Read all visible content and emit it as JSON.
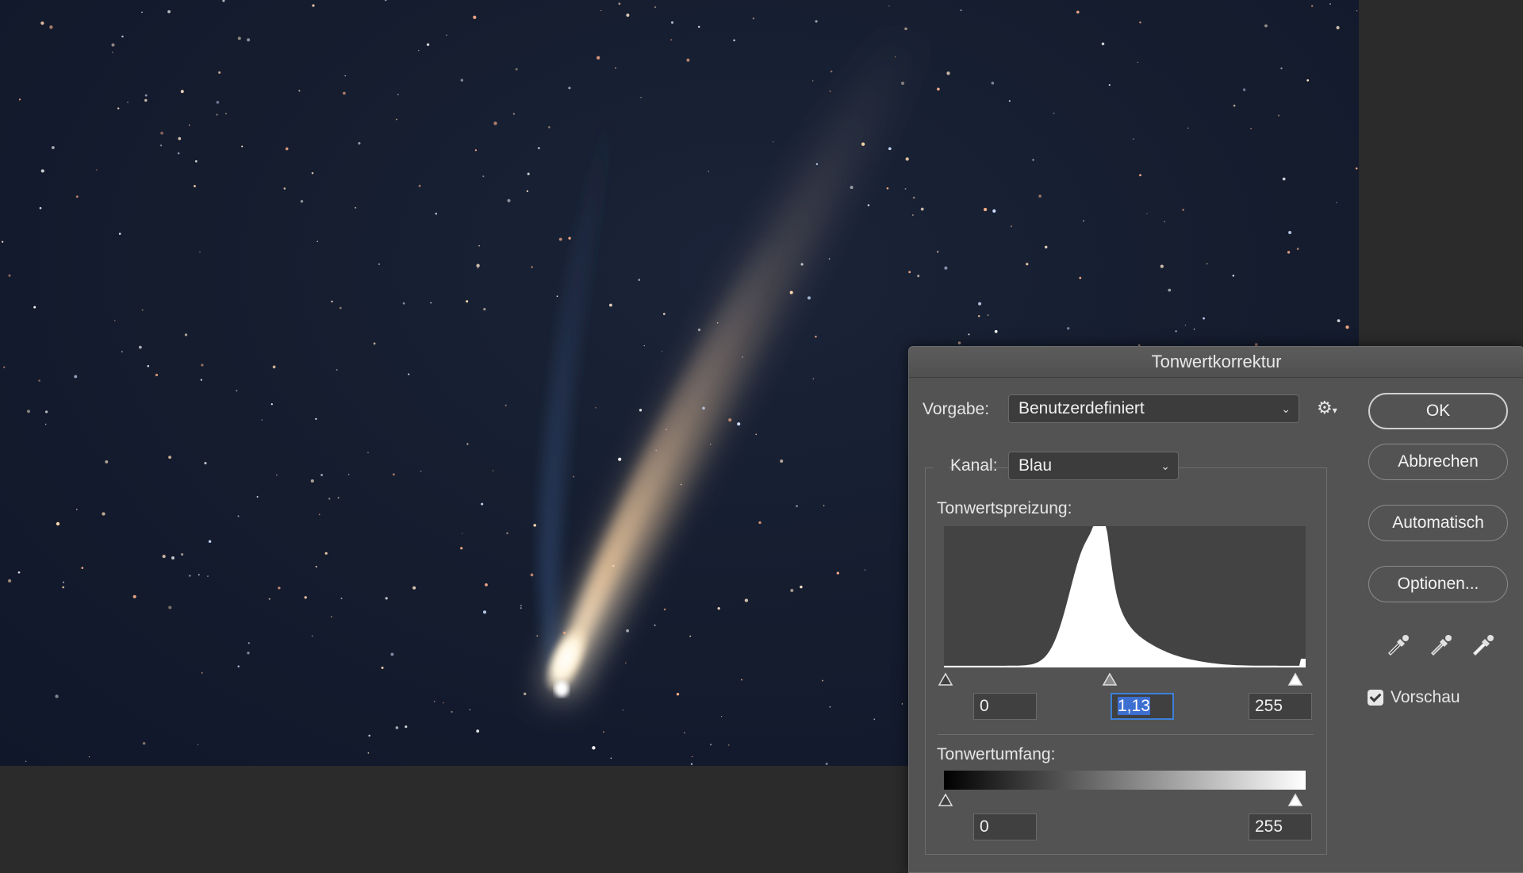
{
  "dialog": {
    "title": "Tonwertkorrektur",
    "preset_label": "Vorgabe:",
    "preset_value": "Benutzerdefiniert",
    "channel_label": "Kanal:",
    "channel_value": "Blau",
    "input_levels_label": "Tonwertspreizung:",
    "input_black": "0",
    "input_gamma": "1,13",
    "input_white": "255",
    "output_levels_label": "Tonwertumfang:",
    "output_black": "0",
    "output_white": "255",
    "buttons": {
      "ok": "OK",
      "cancel": "Abbrechen",
      "auto": "Automatisch",
      "options": "Optionen..."
    },
    "preview_label": "Vorschau",
    "preview_checked": true,
    "icons": {
      "gear": "gear-icon",
      "eyedroppers": [
        "black-point-eyedropper-icon",
        "gray-point-eyedropper-icon",
        "white-point-eyedropper-icon"
      ]
    }
  },
  "colors": {
    "dialog_bg": "#535353",
    "selection_blue": "#3d6fd0"
  }
}
